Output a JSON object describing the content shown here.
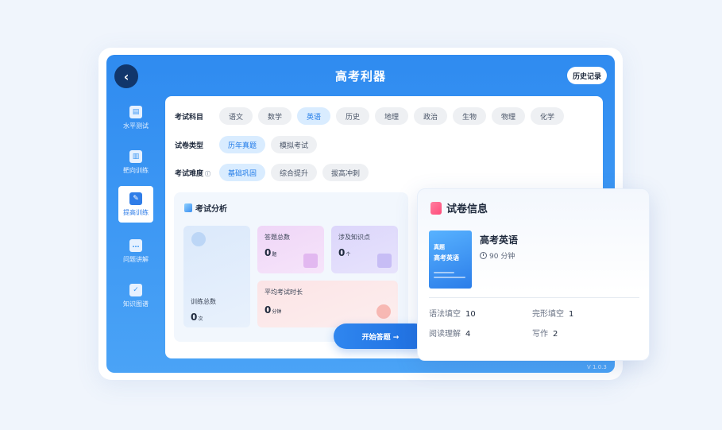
{
  "app": {
    "title": "高考利器",
    "history_label": "历史记录",
    "version": "V 1.0.3"
  },
  "sidebar": {
    "items": [
      {
        "label": "水平测试",
        "icon": "chart-icon"
      },
      {
        "label": "靶向训练",
        "icon": "target-icon"
      },
      {
        "label": "提高训练",
        "icon": "edit-icon",
        "active": true
      },
      {
        "label": "问题讲解",
        "icon": "chat-icon"
      },
      {
        "label": "知识图谱",
        "icon": "graph-icon"
      }
    ]
  },
  "filters": {
    "subject": {
      "label": "考试科目",
      "options": [
        "语文",
        "数学",
        "英语",
        "历史",
        "地理",
        "政治",
        "生物",
        "物理",
        "化学"
      ],
      "selected": "英语"
    },
    "paper_type": {
      "label": "试卷类型",
      "options": [
        "历年真题",
        "模拟考试"
      ],
      "selected": "历年真题"
    },
    "difficulty": {
      "label": "考试难度",
      "options": [
        "基础巩固",
        "综合提升",
        "拔高冲刺"
      ],
      "selected": "基础巩固"
    }
  },
  "analysis": {
    "title": "考试分析",
    "training_total": {
      "label": "训练总数",
      "value": "0",
      "unit": "次"
    },
    "answer_total": {
      "label": "答题总数",
      "value": "0",
      "unit": "题"
    },
    "knowledge_points": {
      "label": "涉及知识点",
      "value": "0",
      "unit": "个"
    },
    "avg_time": {
      "label": "平均考试时长",
      "value": "0",
      "unit": "分钟"
    }
  },
  "start_button": "开始答题 →",
  "paper_info": {
    "title": "试卷信息",
    "cover_tag": "真题",
    "cover_name": "高考英语",
    "name": "高考英语",
    "duration": "90 分钟",
    "questions": [
      {
        "label": "语法填空",
        "count": "10"
      },
      {
        "label": "完形填空",
        "count": "1"
      },
      {
        "label": "阅读理解",
        "count": "4"
      },
      {
        "label": "写作",
        "count": "2"
      }
    ]
  },
  "colors": {
    "primary": "#2f8bf0",
    "dark": "#11366b",
    "accent_pink": "#ff4b7b"
  }
}
